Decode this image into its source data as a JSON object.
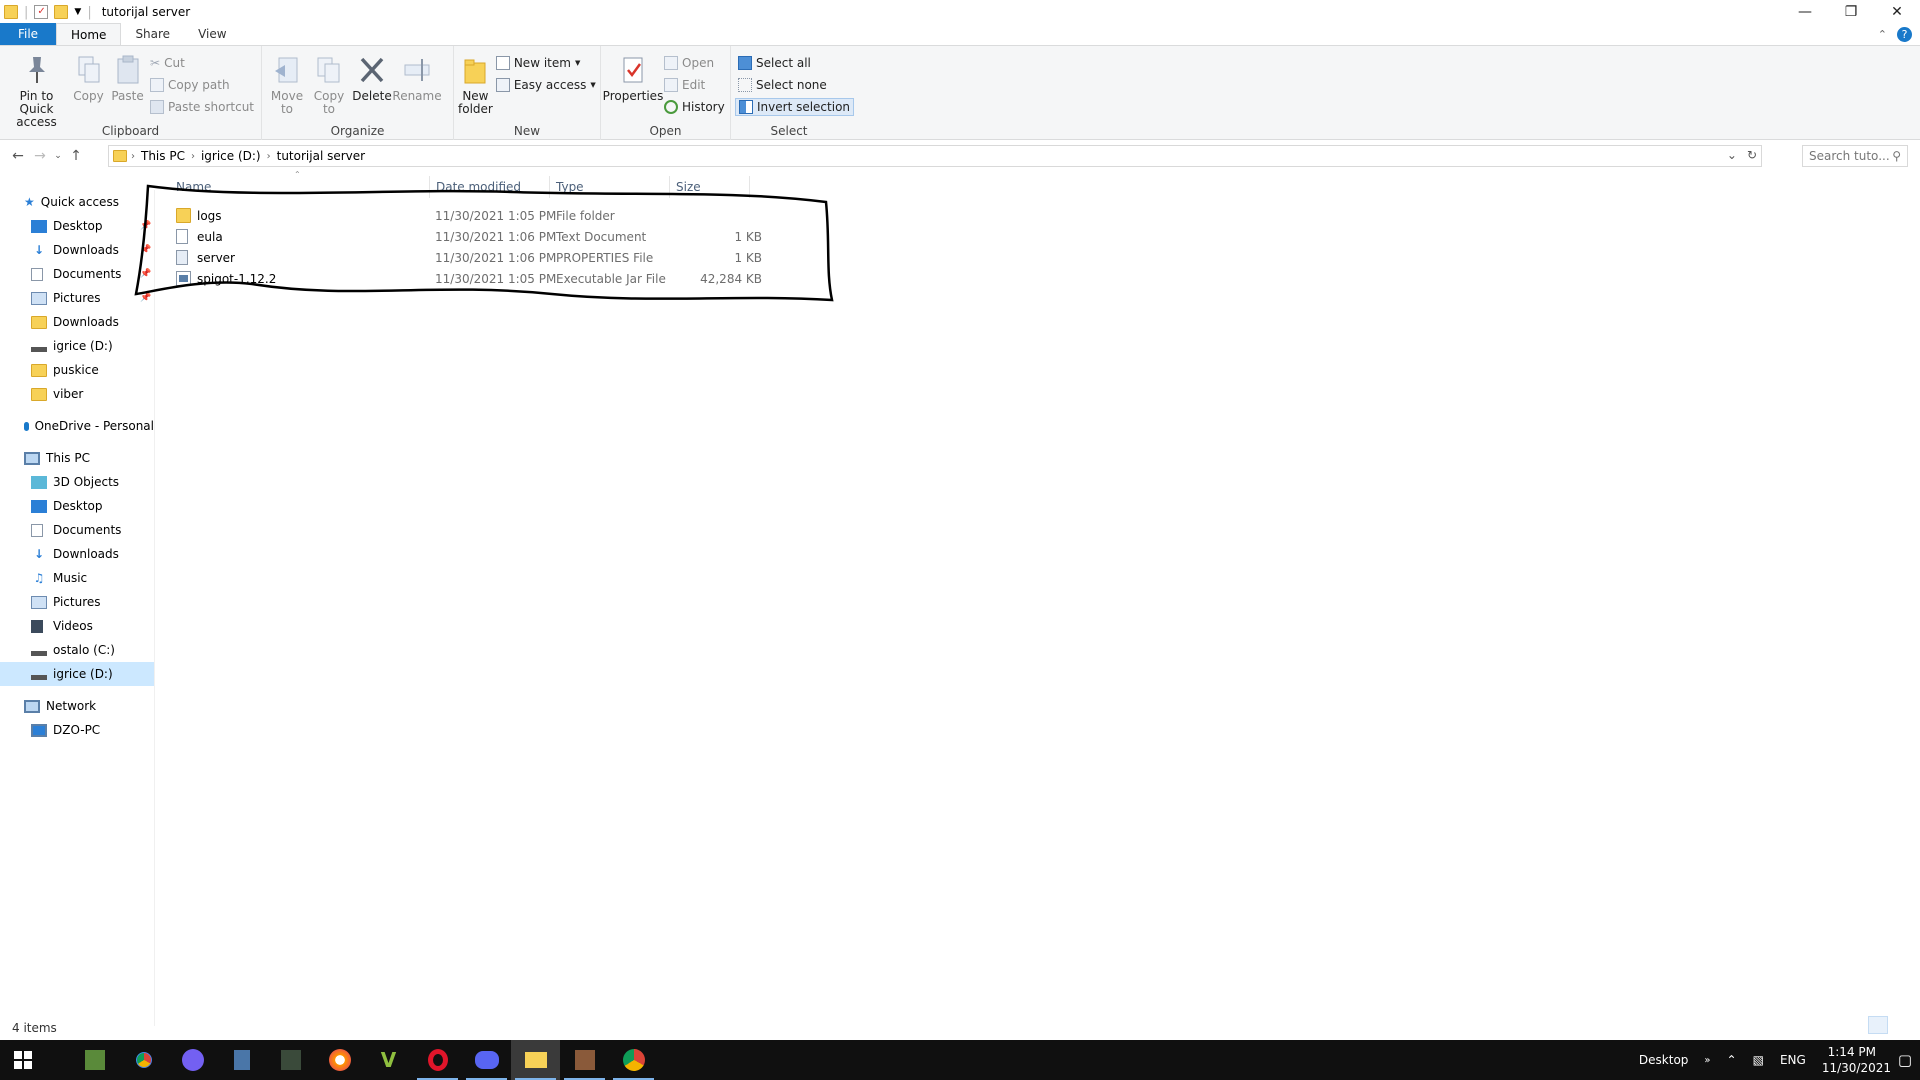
{
  "window": {
    "title": "tutorijal server"
  },
  "tabs": [
    {
      "label": "File"
    },
    {
      "label": "Home"
    },
    {
      "label": "Share"
    },
    {
      "label": "View"
    }
  ],
  "ribbon": {
    "clipboard": {
      "label": "Clipboard",
      "pin": "Pin to Quick access",
      "copy": "Copy",
      "paste": "Paste",
      "cut": "Cut",
      "copy_path": "Copy path",
      "paste_shortcut": "Paste shortcut"
    },
    "organize": {
      "label": "Organize",
      "move_to": "Move to",
      "copy_to": "Copy to",
      "delete": "Delete",
      "rename": "Rename"
    },
    "new": {
      "label": "New",
      "new_folder": "New folder",
      "new_item": "New item",
      "easy_access": "Easy access"
    },
    "open": {
      "label": "Open",
      "properties": "Properties",
      "open": "Open",
      "edit": "Edit",
      "history": "History"
    },
    "select": {
      "label": "Select",
      "select_all": "Select all",
      "select_none": "Select none",
      "invert": "Invert selection"
    }
  },
  "address": {
    "crumbs": [
      "This PC",
      "igrice (D:)",
      "tutorijal server"
    ],
    "search_placeholder": "Search tuto..."
  },
  "nav": {
    "quick_access": "Quick access",
    "quick_items": [
      "Desktop",
      "Downloads",
      "Documents",
      "Pictures",
      "Downloads",
      "igrice (D:)",
      "puskice",
      "viber"
    ],
    "onedrive": "OneDrive - Personal",
    "this_pc": "This PC",
    "pc_items": [
      "3D Objects",
      "Desktop",
      "Documents",
      "Downloads",
      "Music",
      "Pictures",
      "Videos",
      "ostalo (C:)",
      "igrice (D:)"
    ],
    "network": "Network",
    "network_items": [
      "DZO-PC"
    ]
  },
  "columns": {
    "name": "Name",
    "date": "Date modified",
    "type": "Type",
    "size": "Size"
  },
  "files": [
    {
      "name": "logs",
      "date": "11/30/2021 1:05 PM",
      "type": "File folder",
      "size": "",
      "icon": "folder-icon"
    },
    {
      "name": "eula",
      "date": "11/30/2021 1:06 PM",
      "type": "Text Document",
      "size": "1 KB",
      "icon": "text-file-icon"
    },
    {
      "name": "server",
      "date": "11/30/2021 1:06 PM",
      "type": "PROPERTIES File",
      "size": "1 KB",
      "icon": "file-icon"
    },
    {
      "name": "spigot-1.12.2",
      "date": "11/30/2021 1:05 PM",
      "type": "Executable Jar File",
      "size": "42,284 KB",
      "icon": "jar-file-icon"
    }
  ],
  "status": {
    "items": "4 items"
  },
  "taskbar": {
    "desktop": "Desktop",
    "lang": "ENG",
    "time": "1:14 PM",
    "date": "11/30/2021"
  },
  "colors": {
    "accent": "#1979ca",
    "selection": "#cce8ff",
    "folder": "#f7d157",
    "taskbar": "#101010"
  }
}
